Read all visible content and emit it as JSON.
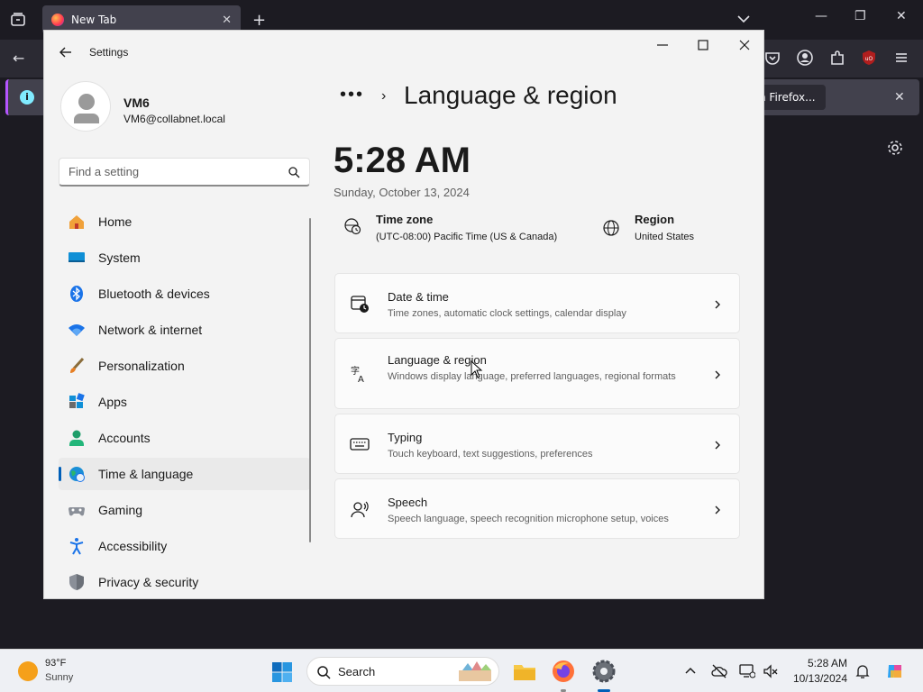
{
  "browser": {
    "tab_title": "New Tab",
    "new_tab_symbol": "+",
    "notification_button_label": "h Firefox..."
  },
  "settings": {
    "window_title": "Settings",
    "user": {
      "name": "VM6",
      "email": "VM6@collabnet.local"
    },
    "search": {
      "placeholder": "Find a setting"
    },
    "nav": [
      {
        "label": "Home",
        "icon": "home-icon"
      },
      {
        "label": "System",
        "icon": "system-icon"
      },
      {
        "label": "Bluetooth & devices",
        "icon": "bluetooth-icon"
      },
      {
        "label": "Network & internet",
        "icon": "wifi-icon"
      },
      {
        "label": "Personalization",
        "icon": "brush-icon"
      },
      {
        "label": "Apps",
        "icon": "apps-icon"
      },
      {
        "label": "Accounts",
        "icon": "accounts-icon"
      },
      {
        "label": "Time & language",
        "icon": "globe-clock-icon",
        "selected": true
      },
      {
        "label": "Gaming",
        "icon": "gamepad-icon"
      },
      {
        "label": "Accessibility",
        "icon": "accessibility-icon"
      },
      {
        "label": "Privacy & security",
        "icon": "shield-icon"
      }
    ],
    "breadcrumb_ellipsis": "•••",
    "breadcrumb_chevron": "›",
    "page_title": "Language & region",
    "clock": {
      "time": "5:28 AM",
      "date": "Sunday, October 13, 2024"
    },
    "time_zone": {
      "label": "Time zone",
      "value": "(UTC-08:00) Pacific Time (US & Canada)"
    },
    "region": {
      "label": "Region",
      "value": "United States"
    },
    "cards": [
      {
        "title": "Date & time",
        "description": "Time zones, automatic clock settings, calendar display",
        "icon": "calendar-clock-icon"
      },
      {
        "title": "Language & region",
        "description": "Windows display language, preferred languages, regional formats",
        "icon": "language-icon"
      },
      {
        "title": "Typing",
        "description": "Touch keyboard, text suggestions, preferences",
        "icon": "keyboard-icon"
      },
      {
        "title": "Speech",
        "description": "Speech language, speech recognition microphone setup, voices",
        "icon": "speech-icon"
      }
    ]
  },
  "taskbar": {
    "weather": {
      "temp": "93°F",
      "condition": "Sunny"
    },
    "search_label": "Search",
    "time": "5:28 AM",
    "date": "10/13/2024"
  },
  "colors": {
    "accent": "#005fb8",
    "firefox_dark": "#1c1b22",
    "settings_bg": "#f3f3f3"
  }
}
